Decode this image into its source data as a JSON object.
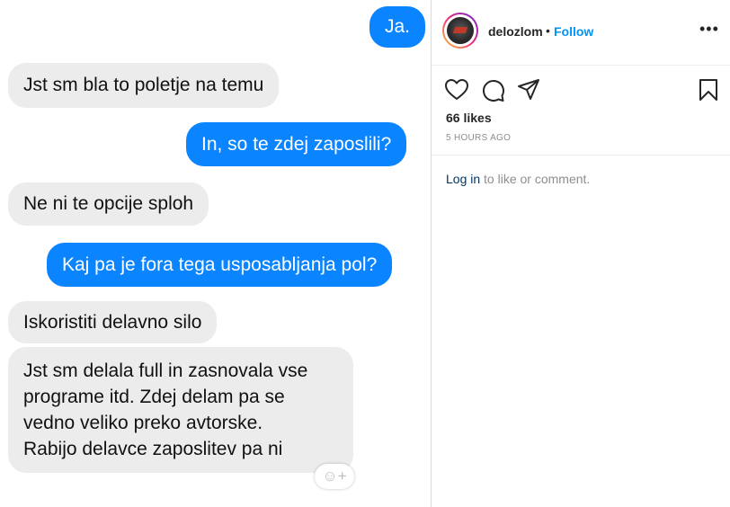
{
  "chat": {
    "messages": [
      {
        "side": "out",
        "text": "Ja."
      },
      {
        "side": "in",
        "text": "Jst sm bla to poletje na temu"
      },
      {
        "side": "out",
        "text": "In, so te zdej zaposlili?"
      },
      {
        "side": "in",
        "text": "Ne ni te opcije sploh"
      },
      {
        "side": "out",
        "text": "Kaj pa je fora tega usposabljanja pol?"
      },
      {
        "side": "in",
        "text": "Iskoristiti delavno silo"
      },
      {
        "side": "in",
        "lines": [
          "Jst sm delala full in zasnovala vse",
          "programe itd. Zdej delam pa se",
          "vedno veliko preko avtorske.",
          "Rabijo delavce zaposlitev pa ni"
        ]
      }
    ],
    "emoji_button": "☺+"
  },
  "post": {
    "username": "delozlom",
    "separator": "•",
    "follow_label": "Follow",
    "more_label": "•••",
    "likes": "66 likes",
    "time": "5 HOURS AGO",
    "login_link": "Log in",
    "login_rest": " to like or comment."
  },
  "colors": {
    "outgoing": "#0a84ff",
    "incoming": "#ececec",
    "follow": "#0095f6"
  },
  "icons": [
    "heart-icon",
    "comment-icon",
    "share-icon",
    "bookmark-icon",
    "more-icon"
  ]
}
